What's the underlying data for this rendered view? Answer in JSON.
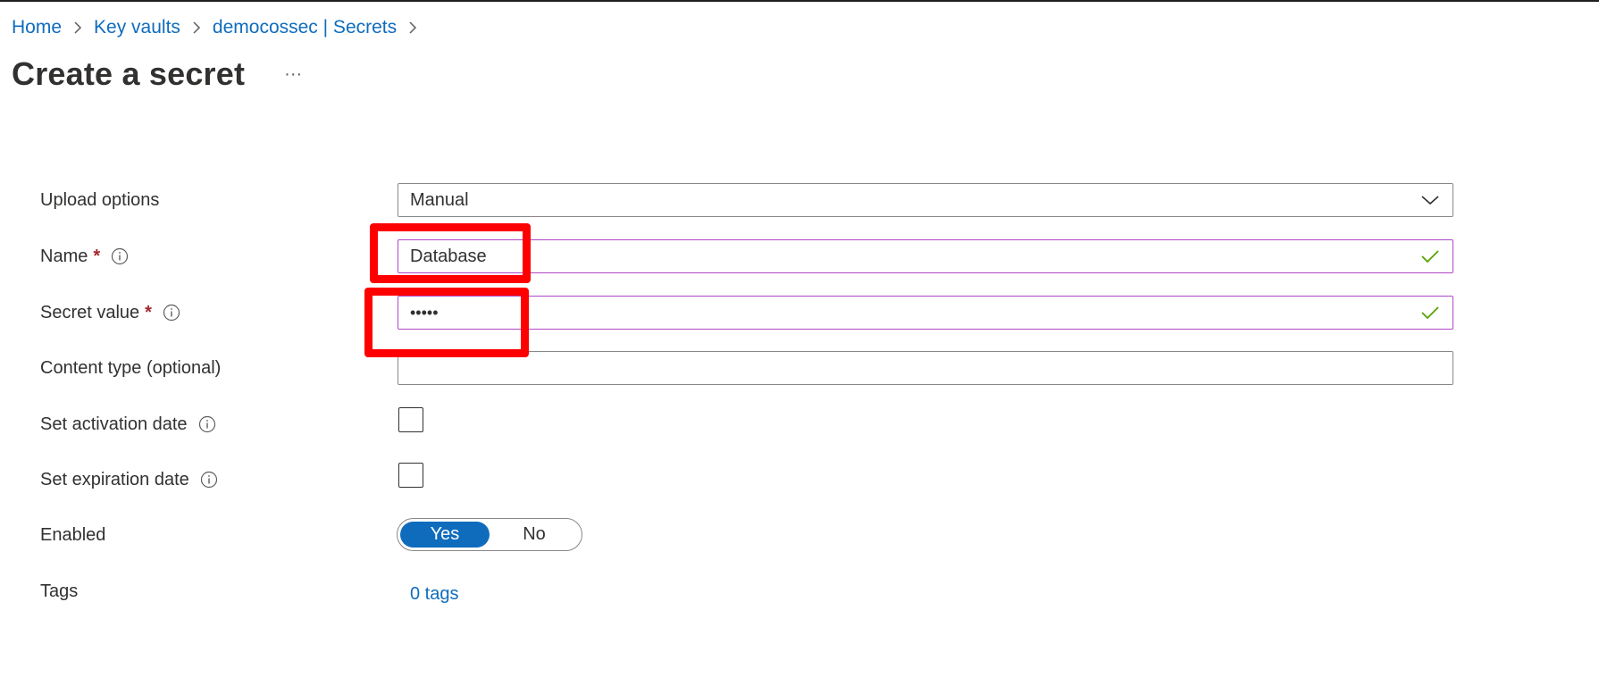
{
  "breadcrumb": {
    "items": [
      "Home",
      "Key vaults",
      "democossec | Secrets"
    ]
  },
  "header": {
    "title": "Create a secret",
    "more_label": "···"
  },
  "form": {
    "upload_options": {
      "label": "Upload options",
      "value": "Manual"
    },
    "name": {
      "label": "Name",
      "required_mark": "*",
      "value": "Database"
    },
    "secret_value": {
      "label": "Secret value",
      "required_mark": "*",
      "masked_value": "•••••"
    },
    "content_type": {
      "label": "Content type (optional)",
      "value": ""
    },
    "activation_date": {
      "label": "Set activation date",
      "checked": false
    },
    "expiration_date": {
      "label": "Set expiration date",
      "checked": false
    },
    "enabled": {
      "label": "Enabled",
      "options": [
        "Yes",
        "No"
      ],
      "selected": "Yes"
    },
    "tags": {
      "label": "Tags",
      "link": "0 tags"
    }
  },
  "colors": {
    "link": "#0f6cbd",
    "toggle_selected": "#0f6cbd",
    "valid_border": "#b147c8",
    "valid_check": "#57a300",
    "required": "#a4262c",
    "annotation_box": "#ff0000"
  },
  "icons": {
    "breadcrumb_separator": "chevron-right-icon",
    "info": "info-icon",
    "dropdown": "chevron-down-icon",
    "valid": "checkmark-icon"
  }
}
